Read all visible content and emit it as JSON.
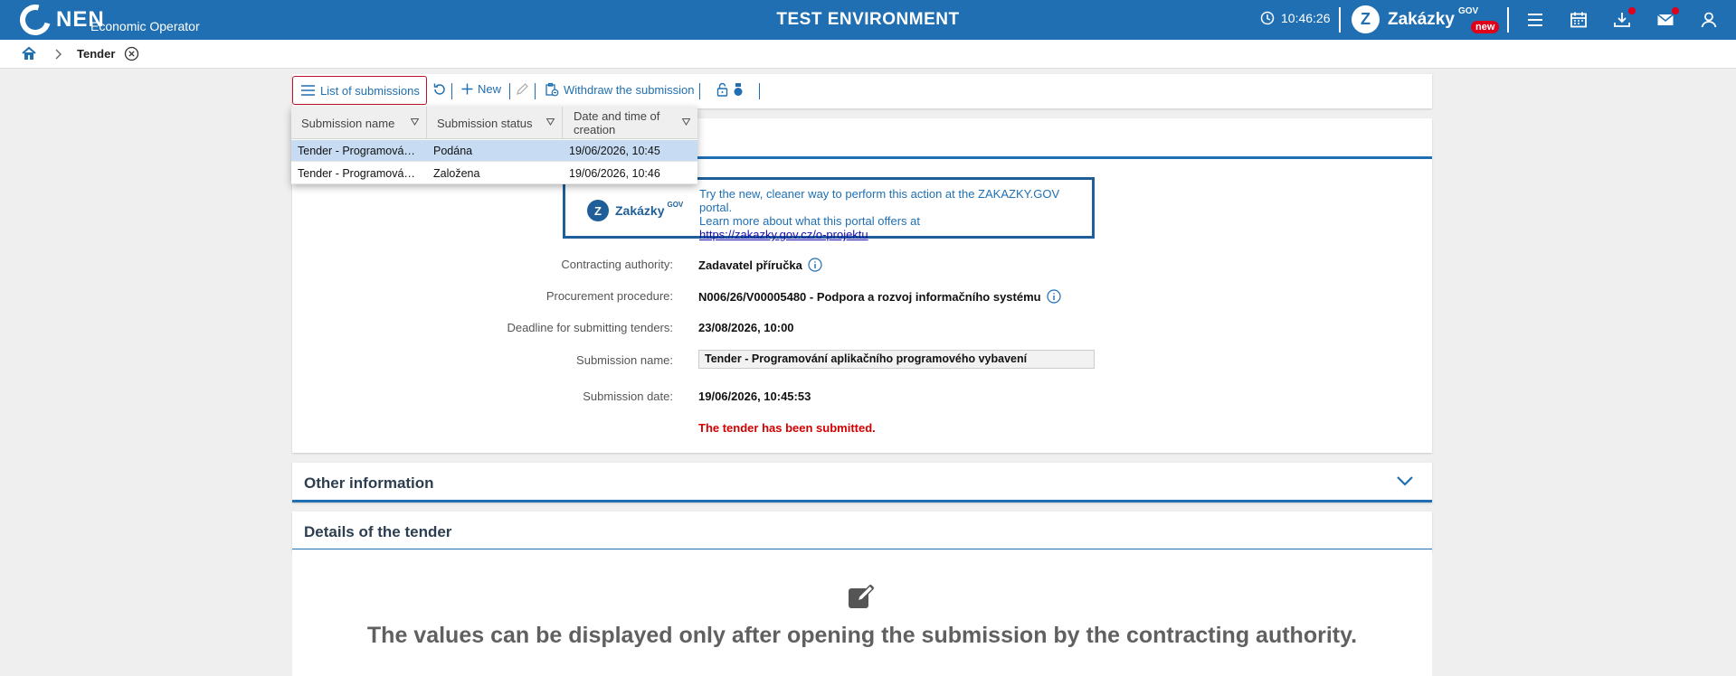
{
  "header": {
    "logo_text": "NEN",
    "logo_subtitle": "Economic Operator",
    "environment_title": "TEST ENVIRONMENT",
    "clock_time": "10:46:26",
    "zakazky_name": "Zakázky",
    "zakazky_gov": "GOV",
    "zakazky_badge": "new",
    "zakazky_letter": "Z"
  },
  "breadcrumb": {
    "current": "Tender"
  },
  "toolbar": {
    "list_label": "List of submissions",
    "new_label": "New",
    "withdraw_label": "Withdraw the submission"
  },
  "submissions_dropdown": {
    "columns": [
      "Submission name",
      "Submission status",
      "Date and time of creation"
    ],
    "rows": [
      {
        "name": "Tender - Programování aplikačního programového vybavení",
        "status": "Podána",
        "created": "19/06/2026, 10:45"
      },
      {
        "name": "Tender - Programování aplikačního programového vybavení",
        "status": "Založena",
        "created": "19/06/2026, 10:46"
      }
    ]
  },
  "promo": {
    "logo_name": "Zakázky",
    "logo_gov": "GOV",
    "line1": "Try the new, cleaner way to perform this action at the ZAKAZKY.GOV portal.",
    "line2": "Learn more about what this portal offers at",
    "link": "https://zakazky.gov.cz/o-projektu"
  },
  "form": {
    "contracting_authority_label": "Contracting authority:",
    "contracting_authority_value": "Zadavatel příručka",
    "procedure_label": "Procurement procedure:",
    "procedure_value": "N006/26/V00005480 - Podpora a rozvoj informačního systému",
    "deadline_label": "Deadline for submitting tenders:",
    "deadline_value": "23/08/2026, 10:00",
    "submission_name_label": "Submission name:",
    "submission_name_value": "Tender - Programování aplikačního programového vybavení",
    "submission_date_label": "Submission date:",
    "submission_date_value": "19/06/2026, 10:45:53",
    "status_message": "The tender has been submitted."
  },
  "sections": {
    "other_info_title": "Other information",
    "details_title": "Details of the tender",
    "details_message": "The values can be displayed only after opening the submission by the contracting authority."
  },
  "colors": {
    "primary": "#1f6fb2",
    "alert": "#d40000",
    "badge": "#e1001a",
    "selected_row": "#c7dcf3"
  }
}
